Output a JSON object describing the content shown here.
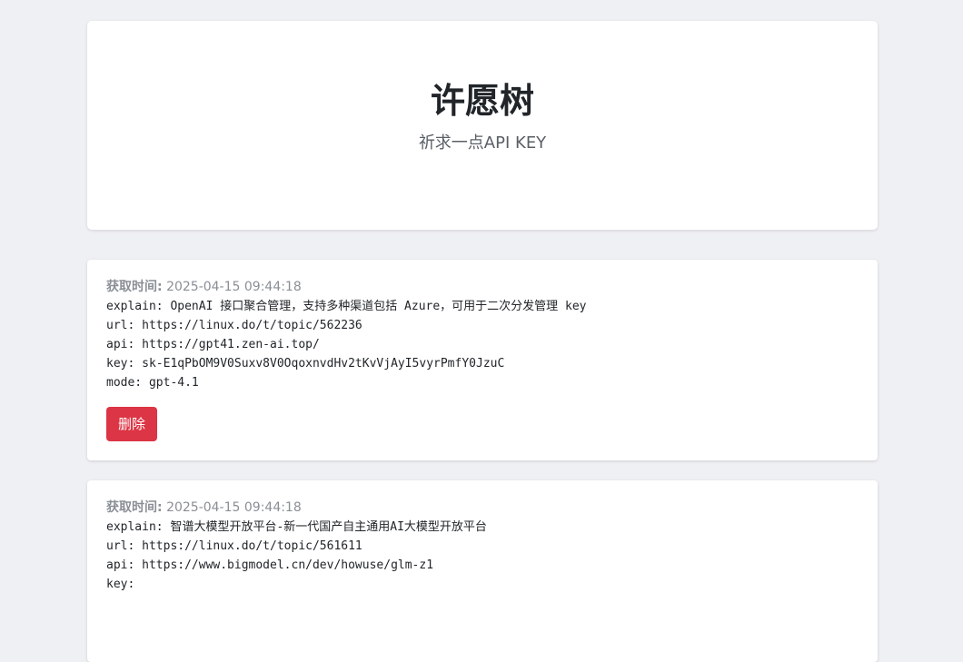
{
  "header": {
    "title": "许愿树",
    "subtitle": "祈求一点API KEY"
  },
  "entries": [
    {
      "time_label": "获取时间:",
      "time_value": "2025-04-15 09:44:18",
      "explain_line": "explain: OpenAI 接口聚合管理，支持多种渠道包括 Azure，可用于二次分发管理 key",
      "url_line": "url: https://linux.do/t/topic/562236",
      "api_line": "api: https://gpt41.zen-ai.top/",
      "key_line": "key: sk-E1qPbOM9V0Suxv8V0OqoxnvdHv2tKvVjAyI5vyrPmfY0JzuC",
      "mode_line": "mode: gpt-4.1",
      "delete_label": "删除"
    },
    {
      "time_label": "获取时间:",
      "time_value": "2025-04-15 09:44:18",
      "explain_line": "explain: 智谱大模型开放平台-新一代国产自主通用AI大模型开放平台",
      "url_line": "url: https://linux.do/t/topic/561611",
      "api_line": "api: https://www.bigmodel.cn/dev/howuse/glm-z1",
      "key_line": "key:"
    }
  ],
  "colors": {
    "background": "#eff0f4",
    "delete_button": "#dc3545"
  }
}
